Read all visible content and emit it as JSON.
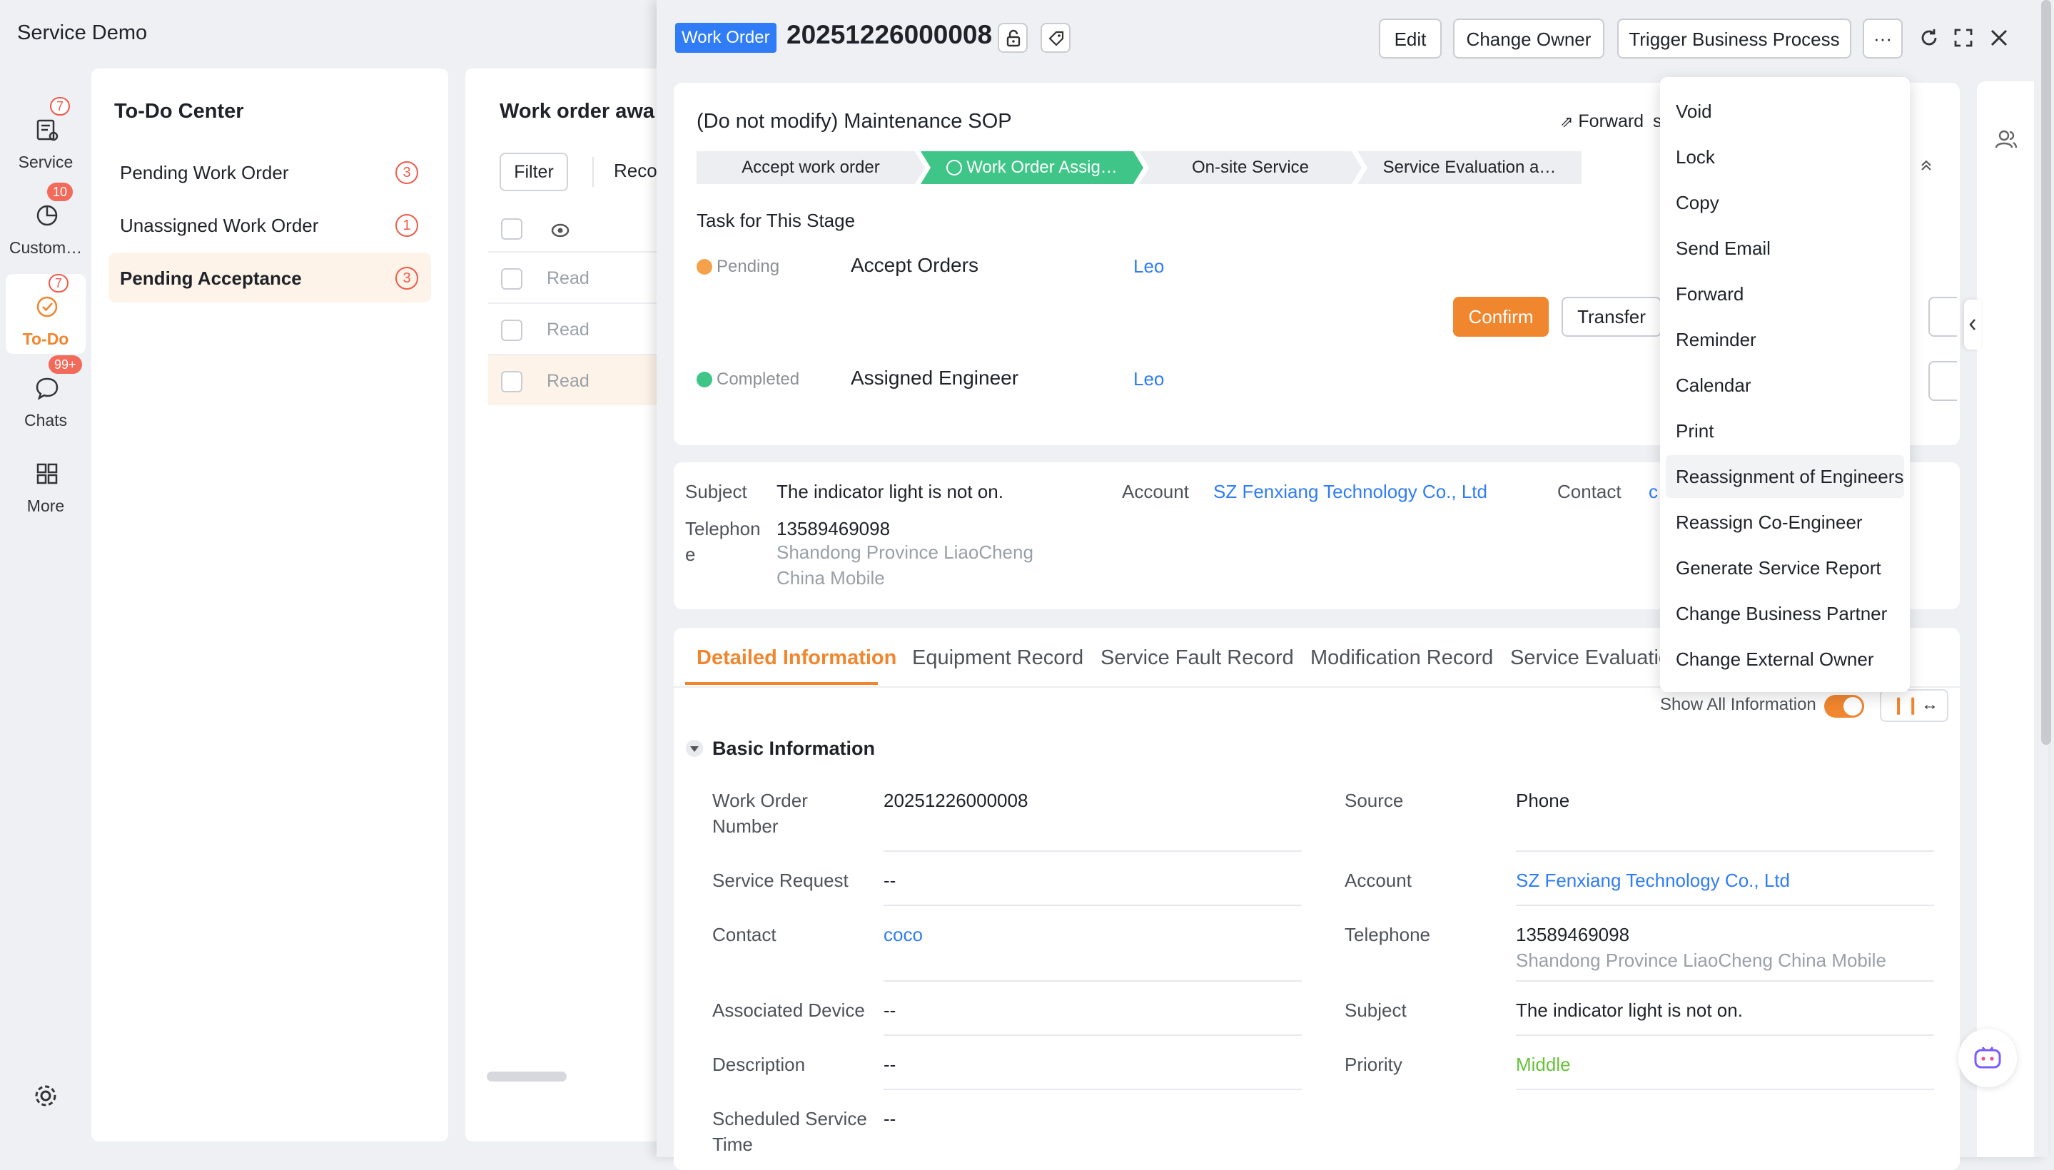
{
  "app": {
    "title": "Service Demo"
  },
  "nav": [
    {
      "label": "Service",
      "badge": "7",
      "icon": "service-icon"
    },
    {
      "label": "Custom…",
      "badge": "10",
      "icon": "customer-icon"
    },
    {
      "label": "To-Do",
      "badge": "7",
      "icon": "todo-icon",
      "active": true
    },
    {
      "label": "Chats",
      "badge": "99+",
      "icon": "chat-icon"
    },
    {
      "label": "More",
      "badge": "",
      "icon": "grid-icon"
    }
  ],
  "todo": {
    "title": "To-Do Center",
    "items": [
      {
        "label": "Pending Work Order",
        "count": "3"
      },
      {
        "label": "Unassigned Work Order",
        "count": "1"
      },
      {
        "label": "Pending Acceptance",
        "count": "3"
      }
    ]
  },
  "list": {
    "title": "Work order awa",
    "filter_label": "Filter",
    "rec_label": "Reco",
    "rows": [
      "Read",
      "Read",
      "Read"
    ]
  },
  "header": {
    "tag": "Work Order",
    "number": "20251226000008",
    "edit_label": "Edit",
    "change_owner_label": "Change Owner",
    "trigger_label": "Trigger Business Process",
    "more_label": "···"
  },
  "sop": {
    "title": "(Do not modify) Maintenance SOP",
    "forward_label": "Forward",
    "partial_label": "ss",
    "stages": [
      "Accept work order",
      "Work Order Assig…",
      "On-site Service",
      "Service Evaluation a…"
    ],
    "task_heading": "Task for This Stage",
    "tasks": [
      {
        "status": "Pending",
        "name": "Accept Orders",
        "owner": "Leo"
      },
      {
        "status": "Completed",
        "name": "Assigned Engineer",
        "owner": "Leo"
      }
    ],
    "confirm_label": "Confirm",
    "transfer_label": "Transfer"
  },
  "summary": {
    "subject_label": "Subject",
    "subject_value": "The indicator light is not on.",
    "account_label": "Account",
    "account_value": "SZ Fenxiang Technology Co., Ltd",
    "contact_label": "Contact",
    "contact_value": "c",
    "telephone_label_1": "Telephon",
    "telephone_label_2": "e",
    "telephone_value": "13589469098",
    "telephone_sub_1": "Shandong Province LiaoCheng",
    "telephone_sub_2": "China Mobile"
  },
  "tabs": [
    "Detailed Information",
    "Equipment Record",
    "Service Fault Record",
    "Modification Record",
    "Service Evaluatic"
  ],
  "show_all_label": "Show All Information",
  "basic": {
    "title": "Basic Information",
    "wo_number_label_1": "Work Order",
    "wo_number_label_2": "Number",
    "wo_number_value": "20251226000008",
    "source_label": "Source",
    "source_value": "Phone",
    "service_request_label": "Service Request",
    "service_request_value": "--",
    "account_label": "Account",
    "account_value": "SZ Fenxiang Technology Co., Ltd",
    "contact_label": "Contact",
    "contact_value": "coco",
    "telephone_label": "Telephone",
    "telephone_value": "13589469098",
    "telephone_sub": "Shandong Province LiaoCheng China Mobile",
    "device_label": "Associated Device",
    "device_value": "--",
    "subject_label": "Subject",
    "subject_value": "The indicator light is not on.",
    "description_label": "Description",
    "description_value": "--",
    "priority_label": "Priority",
    "priority_value": "Middle",
    "scheduled_label_1": "Scheduled Service",
    "scheduled_label_2": "Time",
    "scheduled_value": "--"
  },
  "menu": [
    "Void",
    "Lock",
    "Copy",
    "Send Email",
    "Forward",
    "Reminder",
    "Calendar",
    "Print",
    "Reassignment of Engineers",
    "Reassign Co-Engineer",
    "Generate Service Report",
    "Change Business Partner",
    "Change External Owner"
  ],
  "colors": {
    "accent": "#f0862e",
    "link": "#2f7cf6",
    "stage_active": "#3ec587",
    "tag": "#2f7cf6"
  }
}
